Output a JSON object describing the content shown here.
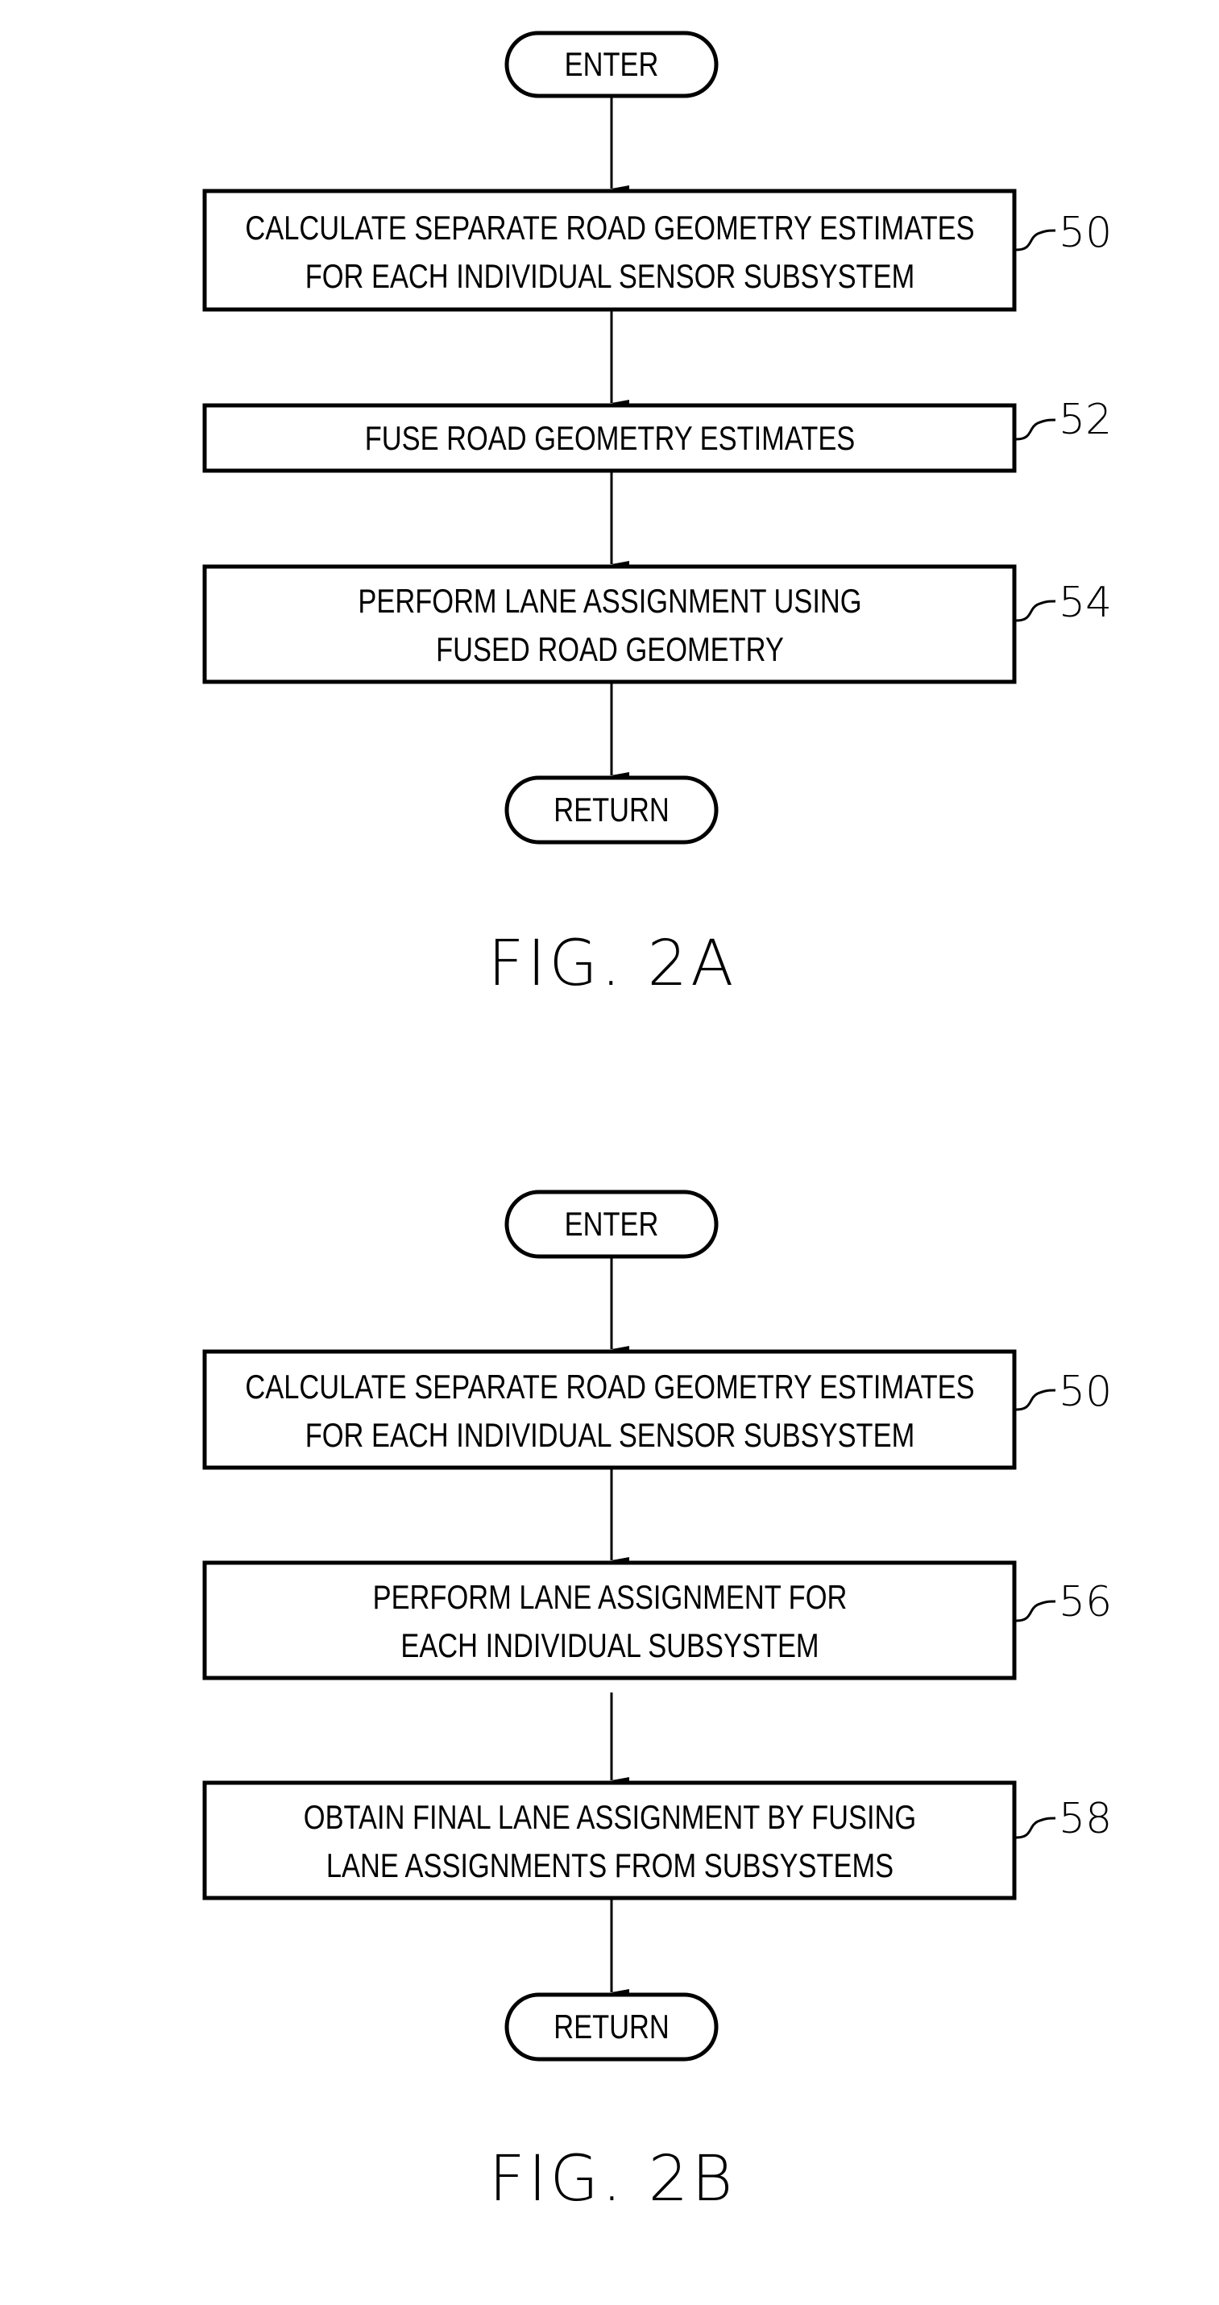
{
  "figures": [
    {
      "caption": "FIG. 2A",
      "start": "ENTER",
      "end": "RETURN",
      "steps": [
        {
          "ref": "50",
          "lines": [
            "CALCULATE SEPARATE ROAD GEOMETRY ESTIMATES",
            "FOR EACH INDIVIDUAL SENSOR SUBSYSTEM"
          ]
        },
        {
          "ref": "52",
          "lines": [
            "FUSE ROAD GEOMETRY ESTIMATES"
          ]
        },
        {
          "ref": "54",
          "lines": [
            "PERFORM LANE ASSIGNMENT USING",
            "FUSED ROAD GEOMETRY"
          ]
        }
      ]
    },
    {
      "caption": "FIG. 2B",
      "start": "ENTER",
      "end": "RETURN",
      "steps": [
        {
          "ref": "50",
          "lines": [
            "CALCULATE SEPARATE ROAD GEOMETRY ESTIMATES",
            "FOR EACH INDIVIDUAL SENSOR SUBSYSTEM"
          ]
        },
        {
          "ref": "56",
          "lines": [
            "PERFORM LANE ASSIGNMENT FOR",
            "EACH INDIVIDUAL SUBSYSTEM"
          ]
        },
        {
          "ref": "58",
          "lines": [
            "OBTAIN FINAL LANE ASSIGNMENT BY FUSING",
            "LANE ASSIGNMENTS FROM SUBSYSTEMS"
          ]
        }
      ]
    }
  ]
}
